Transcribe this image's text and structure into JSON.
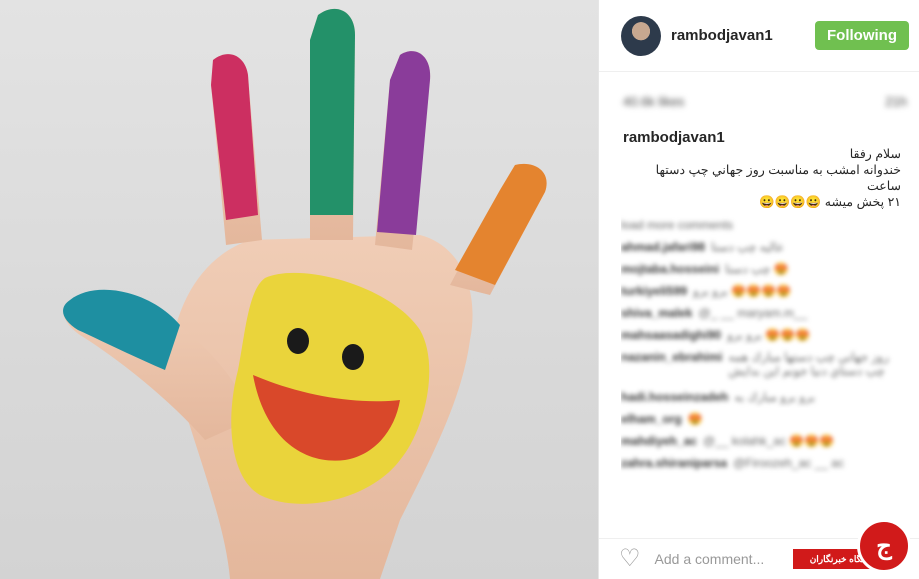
{
  "post": {
    "username": "rambodjavan1",
    "follow_label": "Following",
    "likes": "40.6k likes",
    "time": "21h",
    "caption_user": "rambodjavan1",
    "caption_line1": "سلام رفقا",
    "caption_line2": "خندوانه امشب به مناسبت روز جهاني چپ دستها ساعت",
    "caption_line3": "۲۱ پخش میشه 😀😀😀😀",
    "load_more": "load more comments",
    "add_comment_placeholder": "Add a comment..."
  },
  "comments": [
    {
      "user": "ahmad.jafari98",
      "text": "عالیه چپ دستا"
    },
    {
      "user": "mojtaba.hosseini",
      "text": "چپ دستا 😍"
    },
    {
      "user": "turkiyeli599",
      "text": "برو برو 😍😍😍😍"
    },
    {
      "user": "shiva_malek",
      "text": "@_ __ maryam.m__"
    },
    {
      "user": "mahsaasadighi90",
      "text": "برو برو 😍😍😍"
    },
    {
      "user": "nazanin_ebrahimi",
      "text": "روز جهاني چپ دستها مبارك همه چپ دستاي دنیا جونم این بدایش",
      "tall": true
    },
    {
      "user": "hadi.hosseinzadeh",
      "text": "برو برو مبارك به"
    },
    {
      "user": "elham_org",
      "text": "😍"
    },
    {
      "user": "mahdiyeh_ac",
      "text": "@__ kolahk_ac 😍😍😍"
    },
    {
      "user": "zahra.shiraniparsa",
      "text": "@Firoozeh_ac __ ac"
    }
  ],
  "watermark": {
    "bar_text": "باشگاه خبرنگاران",
    "circle_text": "ج"
  },
  "icons": [
    "heart-icon"
  ],
  "colors": {
    "follow_green": "#70c050",
    "watermark_red": "#d11a1a"
  }
}
